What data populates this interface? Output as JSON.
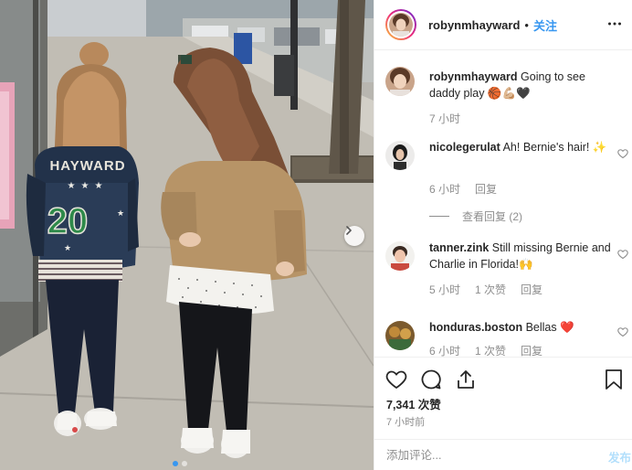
{
  "post": {
    "username": "robynmhayward",
    "separator": "•",
    "follow_label": "关注",
    "caption_text": "Going to see daddy play 🏀💪🏼🖤",
    "caption_time": "7 小时",
    "likes": "7,341 次赞",
    "posted_time": "7 小时前",
    "add_comment_placeholder": "添加评论...",
    "post_label": "发布"
  },
  "comments": [
    {
      "username": "nicolegerulat",
      "text": "Ah! Bernie's hair! ✨",
      "time": "6 小时",
      "reply_label": "回复",
      "view_replies": "查看回复 (2)"
    },
    {
      "username": "tanner.zink",
      "text": "Still missing Bernie and Charlie in Florida!🙌",
      "time": "5 小时",
      "likes": "1 次赞",
      "reply_label": "回复"
    },
    {
      "username": "honduras.boston",
      "text": "Bellas ❤️",
      "time": "6 小时",
      "likes": "1 次赞",
      "reply_label": "回复"
    }
  ],
  "photo": {
    "jacket_name": "HAYWARD",
    "jacket_number": "20"
  },
  "colors": {
    "accent": "#3897f0",
    "accent_disabled": "#b2dffc",
    "muted": "#8e8e8e",
    "text": "#262626",
    "border": "#efefef"
  },
  "icons": [
    "more-icon",
    "heart-icon",
    "comment-icon",
    "share-icon",
    "bookmark-icon",
    "chevron-right-icon"
  ]
}
